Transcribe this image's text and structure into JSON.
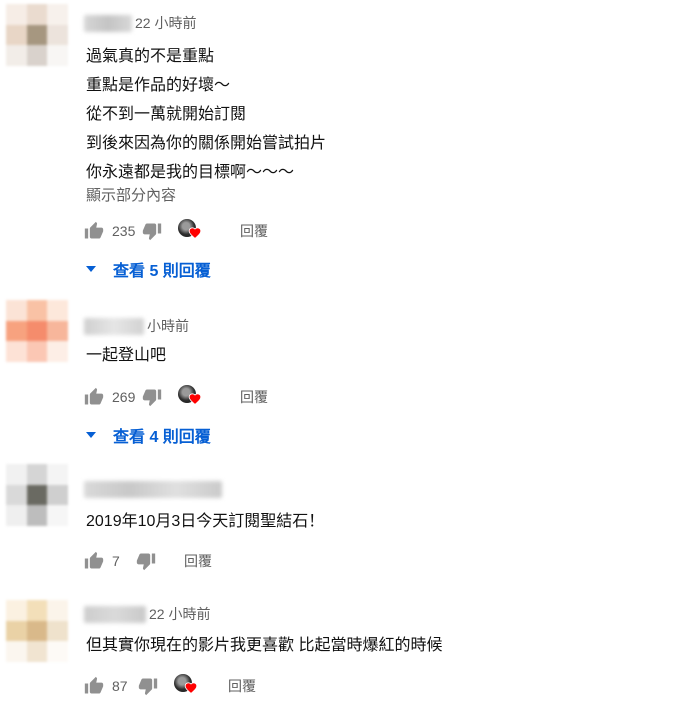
{
  "comments": [
    {
      "time": "22 小時前",
      "lines": [
        "過氣真的不是重點",
        "重點是作品的好壞～",
        "從不到一萬就開始訂閱",
        "到後來因為你的關係開始嘗試拍片",
        "你永遠都是我的目標啊～～～"
      ],
      "show_more": "顯示部分內容",
      "likes": "235",
      "reply_label": "回覆",
      "view_replies": "查看 5 則回覆"
    },
    {
      "time": "小時前",
      "lines": [
        "一起登山吧"
      ],
      "likes": "269",
      "reply_label": "回覆",
      "view_replies": "查看 4 則回覆"
    },
    {
      "lines": [
        "2019年10月3日今天訂閱聖結石！"
      ],
      "likes": "7",
      "reply_label": "回覆"
    },
    {
      "time": "22 小時前",
      "lines": [
        "但其實你現在的影片我更喜歡 比起當時爆紅的時候"
      ],
      "likes": "87",
      "reply_label": "回覆"
    }
  ],
  "icons": {
    "like": "thumb-up-icon",
    "dislike": "thumb-down-icon",
    "creator_heart": "creator-heart-icon",
    "expand": "caret-down-icon"
  },
  "colors": {
    "link": "#065fd4",
    "meta": "#606060",
    "heart": "#ff0000"
  }
}
